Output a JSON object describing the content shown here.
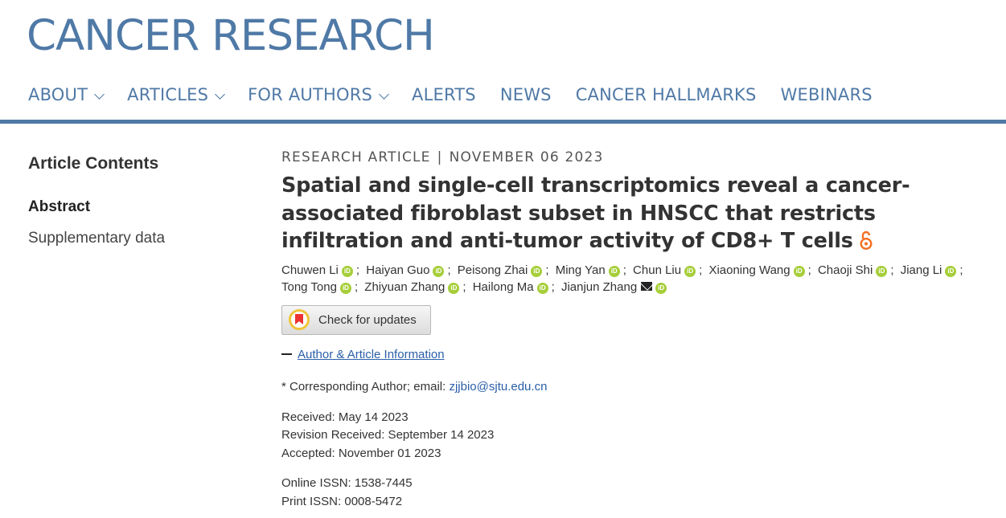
{
  "header": {
    "logo": "CANCER RESEARCH",
    "nav": [
      {
        "label": "ABOUT",
        "dropdown": true
      },
      {
        "label": "ARTICLES",
        "dropdown": true
      },
      {
        "label": "FOR AUTHORS",
        "dropdown": true
      },
      {
        "label": "ALERTS",
        "dropdown": false
      },
      {
        "label": "NEWS",
        "dropdown": false
      },
      {
        "label": "CANCER HALLMARKS",
        "dropdown": false
      },
      {
        "label": "WEBINARS",
        "dropdown": false
      }
    ]
  },
  "sidebar": {
    "heading": "Article Contents",
    "items": [
      "Abstract",
      "Supplementary data"
    ]
  },
  "article": {
    "type": "RESEARCH ARTICLE",
    "separator": "|",
    "date": "NOVEMBER 06 2023",
    "title": "Spatial and single-cell transcriptomics reveal a cancer-associated fibroblast subset in HNSCC that restricts infiltration and anti-tumor activity of CD8+ T cells",
    "authors": [
      "Chuwen Li",
      "Haiyan Guo",
      "Peisong Zhai",
      "Ming Yan",
      "Chun Liu",
      "Xiaoning Wang",
      "Chaoji Shi",
      "Jiang Li",
      "Tong Tong",
      "Zhiyuan Zhang",
      "Hailong Ma",
      "Jianjun Zhang"
    ],
    "author_separator": ";",
    "orcid_badge": "iD",
    "check_updates_label": "Check for updates",
    "info_link": "Author & Article Information",
    "corresponding_label": "* Corresponding Author; email:",
    "corresponding_email": "zjjbio@sjtu.edu.cn",
    "received": "Received: May 14 2023",
    "revision_received": "Revision Received: September 14 2023",
    "accepted": "Accepted: November 01 2023",
    "online_issn": "Online ISSN: 1538-7445",
    "print_issn": "Print ISSN: 0008-5472"
  },
  "colors": {
    "brand": "#4f79a6",
    "orcid": "#a6ce39",
    "open_access": "#f26f21",
    "link": "#2a5ea8"
  },
  "icons": [
    "chevron-down-icon",
    "open-access-icon",
    "orcid-icon",
    "mail-icon",
    "check-for-updates-icon"
  ]
}
